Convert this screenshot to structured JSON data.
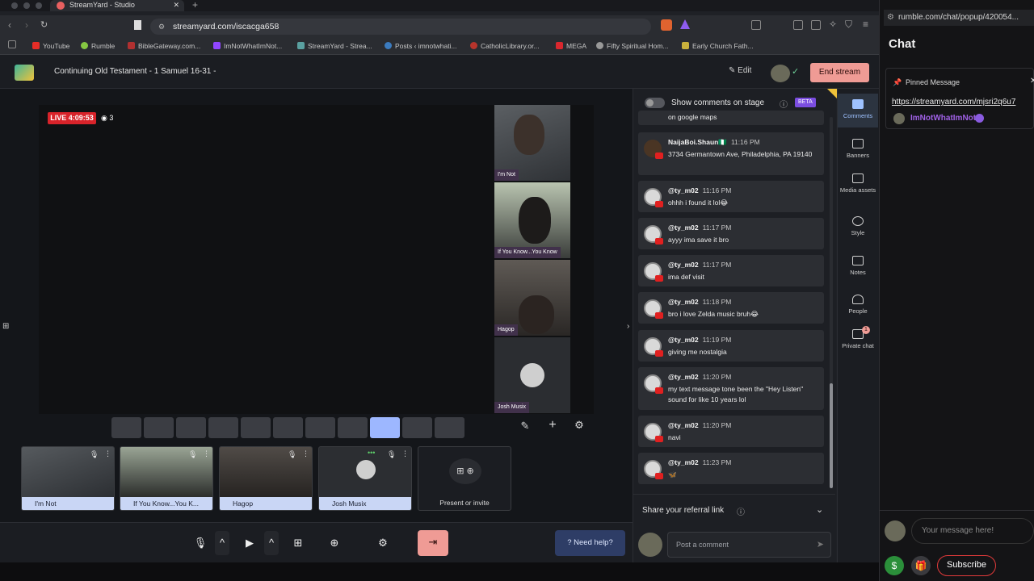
{
  "browser": {
    "tab_title": "StreamYard - Studio",
    "url": "streamyard.com/iscacga658",
    "bookmarks": [
      "YouTube",
      "Rumble",
      "BibleGateway.com...",
      "ImNotWhatImNot...",
      "StreamYard - Strea...",
      "Posts ‹ imnotwhati...",
      "CatholicLibrary.or...",
      "MEGA",
      "Fifty Spiritual Hom...",
      "Early Church Fath..."
    ]
  },
  "header": {
    "broadcast_title": "Continuing Old Testament - 1 Samuel 16-31 -",
    "edit_label": "Edit",
    "end_stream_label": "End stream"
  },
  "stage": {
    "live_badge": "LIVE 4:09:53",
    "viewer_count": "3",
    "participants": [
      "I'm Not",
      "If You Know...You Know",
      "Hagop",
      "Josh Musix"
    ]
  },
  "backstage": {
    "items": [
      "I'm Not",
      "If You Know...You K...",
      "Hagop",
      "Josh Musix"
    ],
    "present_label": "Present or invite"
  },
  "toolbar": {
    "help_label": "Need help?"
  },
  "comments": {
    "show_on_stage_label": "Show comments on stage",
    "beta_label": "BETA",
    "partial_text": "on google maps",
    "items": [
      {
        "user": "NaijaBoi.Shaun🇳🇬",
        "time": "11:16 PM",
        "text": "3734 Germantown Ave, Philadelphia, PA 19140"
      },
      {
        "user": "@ty_m02",
        "time": "11:16 PM",
        "text": "ohhh i found it lol😂"
      },
      {
        "user": "@ty_m02",
        "time": "11:17 PM",
        "text": "ayyy ima save it bro"
      },
      {
        "user": "@ty_m02",
        "time": "11:17 PM",
        "text": "ima def visit"
      },
      {
        "user": "@ty_m02",
        "time": "11:18 PM",
        "text": "bro i love Zelda music bruh😂"
      },
      {
        "user": "@ty_m02",
        "time": "11:19 PM",
        "text": "giving me nostalgia"
      },
      {
        "user": "@ty_m02",
        "time": "11:20 PM",
        "text": "my text message tone been the \"Hey Listen\" sound for like 10 years lol"
      },
      {
        "user": "@ty_m02",
        "time": "11:20 PM",
        "text": "navi"
      },
      {
        "user": "@ty_m02",
        "time": "11:23 PM",
        "text": "🦋"
      }
    ],
    "referral_label": "Share your referral link",
    "post_placeholder": "Post a comment"
  },
  "rightnav": {
    "items": [
      "Comments",
      "Banners",
      "Media assets",
      "Style",
      "Notes",
      "People",
      "Private chat"
    ],
    "private_chat_badge": "1"
  },
  "rumble": {
    "url": "rumble.com/chat/popup/420054...",
    "chat_title": "Chat",
    "pinned_label": "Pinned Message",
    "pinned_link": "https://streamyard.com/mjsri2q6u7",
    "pinned_user": "ImNotWhatImNot",
    "message_placeholder": "Your message here!",
    "subscribe_label": "Subscribe"
  },
  "colors": {
    "end_stream": "#ef9b95",
    "live": "#d8232a",
    "active_layout": "#9db7ff",
    "rumble_accent": "#a061e6"
  }
}
